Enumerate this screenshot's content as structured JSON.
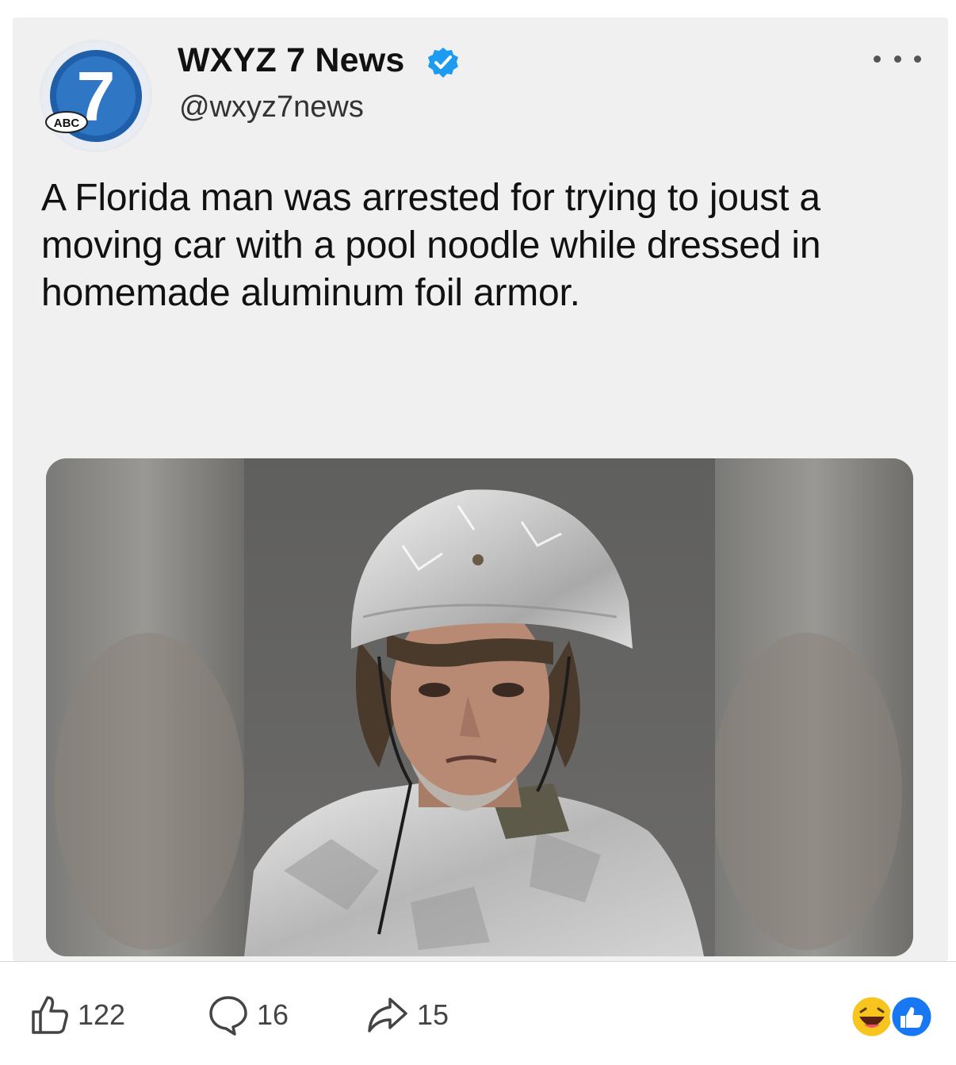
{
  "tweet": {
    "author_name": "WXYZ 7 News",
    "author_handle": "@wxyz7news",
    "logo_number": "7",
    "logo_badge": "ABC",
    "text": "A Florida man was arrested for trying to joust a moving car with a pool noodle while dressed in homemade aluminum foil armor.",
    "media_icon": "mugshot-photo"
  },
  "post_actions": {
    "like_count": "122",
    "comment_count": "16",
    "share_count": "15",
    "reaction_icons": [
      "haha-icon",
      "like-icon"
    ]
  },
  "colors": {
    "verified_blue": "#1d9bf0",
    "facebook_blue": "#1877f2",
    "haha_yellow": "#f7c51e",
    "logo_blue": "#1f5ea8"
  }
}
